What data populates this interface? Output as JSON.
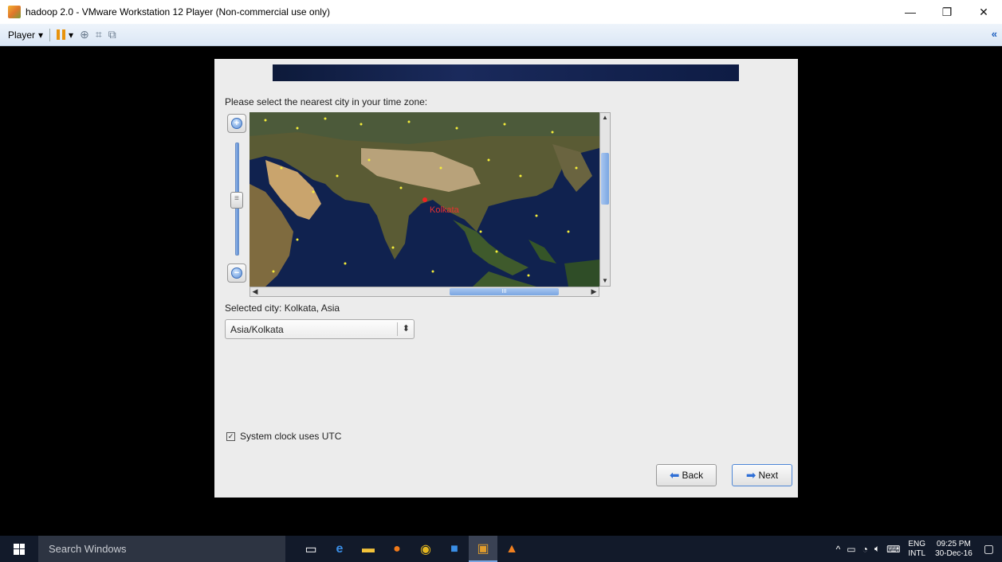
{
  "window": {
    "title": "hadoop 2.0 - VMware Workstation 12 Player (Non-commercial use only)",
    "minimize_glyph": "—",
    "restore_glyph": "❐",
    "close_glyph": "✕"
  },
  "toolbar": {
    "player_label": "Player",
    "player_caret": "▾",
    "pause_caret": "▾",
    "icons": [
      "ctrl-alt-del-icon",
      "fullscreen-icon",
      "unity-icon"
    ],
    "collapse_glyph": "«"
  },
  "installer": {
    "prompt": "Please select the nearest city in your time zone:",
    "map": {
      "selected_city_marker": "Kolkata"
    },
    "scroll_h_label": "III",
    "selected_city_text": "Selected city: Kolkata, Asia",
    "timezone_value": "Asia/Kolkata",
    "timezone_caret": "⬍",
    "utc_checkbox": {
      "checked": true,
      "label": "System clock uses UTC"
    },
    "back_label": "Back",
    "next_label": "Next"
  },
  "taskbar": {
    "search_placeholder": "Search Windows",
    "apps": [
      "task-view-icon",
      "edge-icon",
      "file-explorer-icon",
      "firefox-icon",
      "chrome-icon",
      "store-icon",
      "vmware-icon",
      "vlc-icon"
    ],
    "lang_line1": "ENG",
    "lang_line2": "INTL",
    "time": "09:25 PM",
    "date": "30-Dec-16"
  }
}
